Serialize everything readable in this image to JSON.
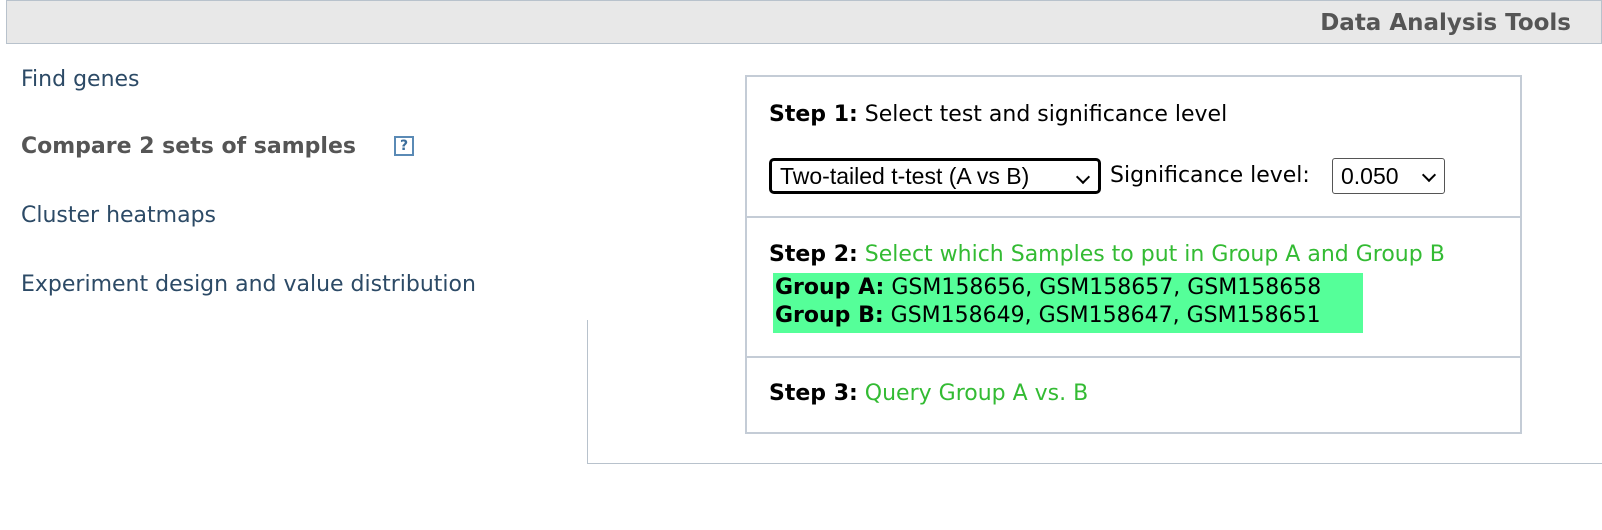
{
  "header": {
    "title": "Data Analysis Tools"
  },
  "nav": {
    "find_genes": "Find genes",
    "compare": "Compare 2 sets of samples",
    "compare_help": "?",
    "cluster": "Cluster heatmaps",
    "design": "Experiment design and value distribution"
  },
  "step1": {
    "label": "Step 1:",
    "text": "Select test and significance level",
    "test_selected": "Two-tailed t-test (A vs B)",
    "significance_label": "Significance level:",
    "significance_selected": "0.050"
  },
  "step2": {
    "label": "Step 2:",
    "text": "Select which Samples to put in Group A and Group B",
    "group_a_label": "Group A:",
    "group_a_samples": "GSM158656, GSM158657, GSM158658",
    "group_b_label": "Group B:",
    "group_b_samples": "GSM158649, GSM158647, GSM158651"
  },
  "step3": {
    "label": "Step 3:",
    "text": "Query Group A vs. B"
  },
  "colors": {
    "link": "#2c4a66",
    "active_nav": "#555555",
    "step_action": "#33bb33",
    "group_highlight": "#55ff99",
    "header_bg": "#e8e8e8"
  }
}
